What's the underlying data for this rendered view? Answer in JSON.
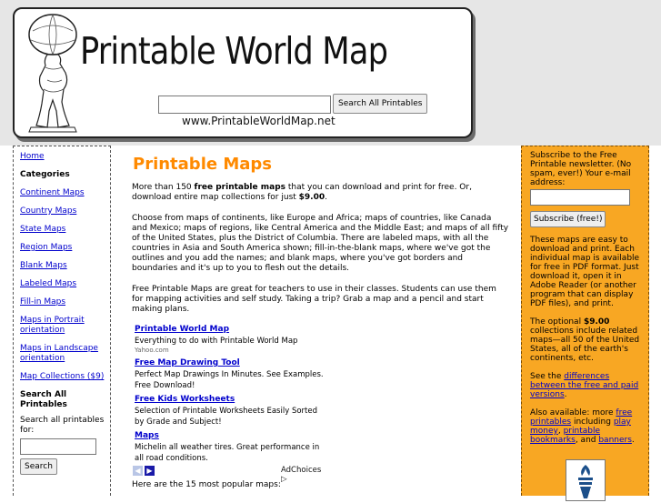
{
  "header": {
    "title": "Printable World Map",
    "search_placeholder": "",
    "search_button": "Search All Printables",
    "url": "www.PrintableWorldMap.net"
  },
  "left_sidebar": {
    "items": [
      {
        "label": "Home",
        "link": true
      },
      {
        "label": "Categories",
        "link": false
      },
      {
        "label": "Continent Maps",
        "link": true
      },
      {
        "label": "Country Maps",
        "link": true
      },
      {
        "label": "State Maps",
        "link": true
      },
      {
        "label": "Region Maps",
        "link": true
      },
      {
        "label": "Blank Maps",
        "link": true
      },
      {
        "label": "Labeled Maps",
        "link": true
      },
      {
        "label": "Fill-in Maps",
        "link": true
      },
      {
        "label": "Maps in Portrait orientation",
        "link": true
      },
      {
        "label": "Maps in Landscape orientation",
        "link": true
      },
      {
        "label": "Map Collections ($9)",
        "link": true
      },
      {
        "label": "Search All Printables",
        "link": false
      }
    ],
    "search_label": "Search all printables for:",
    "search_button": "Search"
  },
  "main": {
    "title": "Printable Maps",
    "intro_pre": "More than 150 ",
    "intro_bold": "free printable maps",
    "intro_mid": " that you can download and print for free. Or, download entire map collections for just ",
    "intro_price": "$9.00",
    "intro_end": ".",
    "para2": "Choose from maps of continents, like Europe and Africa; maps of countries, like Canada and Mexico; maps of regions, like Central America and the Middle East; and maps of all fifty of the United States, plus the District of Columbia. There are labeled maps, with all the countries in Asia and South America shown; fill-in-the-blank maps, where we've got the outlines and you add the names; and blank maps, where you've got borders and boundaries and it's up to you to flesh out the details.",
    "para3": "Free Printable Maps are great for teachers to use in their classes. Students can use them for mapping activities and self study. Taking a trip? Grab a map and a pencil and start making plans.",
    "ads": [
      {
        "title": "Printable World Map",
        "text": "Everything to do with Printable World Map",
        "url": "Yahoo.com"
      },
      {
        "title": "Free Map Drawing Tool",
        "text": "Perfect Map Drawings In Minutes. See Examples. Free Download!",
        "url": ""
      },
      {
        "title": "Free Kids Worksheets",
        "text": "Selection of Printable Worksheets Easily Sorted by Grade and Subject!",
        "url": ""
      },
      {
        "title": "Maps",
        "text": "Michelin all weather tires. Great performance in all road conditions.",
        "url": ""
      }
    ],
    "adchoices": "AdChoices",
    "popular_text": "Here are the 15 most popular maps:"
  },
  "right_sidebar": {
    "subscribe_text": "Subscribe to the Free Printable newsletter. (No spam, ever!) Your e-mail address:",
    "subscribe_button": "Subscribe (free!)",
    "info1": "These maps are easy to download and print. Each individual map is available for free in PDF format. Just download it, open it in Adobe Reader (or another program that can display PDF files), and print.",
    "info2_pre": "The optional ",
    "info2_price": "$9.00",
    "info2_post": " collections include related maps—all 50 of the United States, all of the earth's continents, etc.",
    "see_pre": "See the ",
    "see_link": "differences between the free and paid versions",
    "see_post": ".",
    "also_pre": "Also available: more ",
    "also_link1": "free printables",
    "also_mid1": " including ",
    "also_link2": "play money",
    "also_mid2": ", ",
    "also_link3": "printable bookmarks",
    "also_mid3": ", and ",
    "also_link4": "banners",
    "also_end": "."
  },
  "colors": {
    "accent_orange": "#ff8a00",
    "sidebar_orange": "#f8a723",
    "link_blue": "#0000cc",
    "header_gray": "#e6e6e6"
  }
}
